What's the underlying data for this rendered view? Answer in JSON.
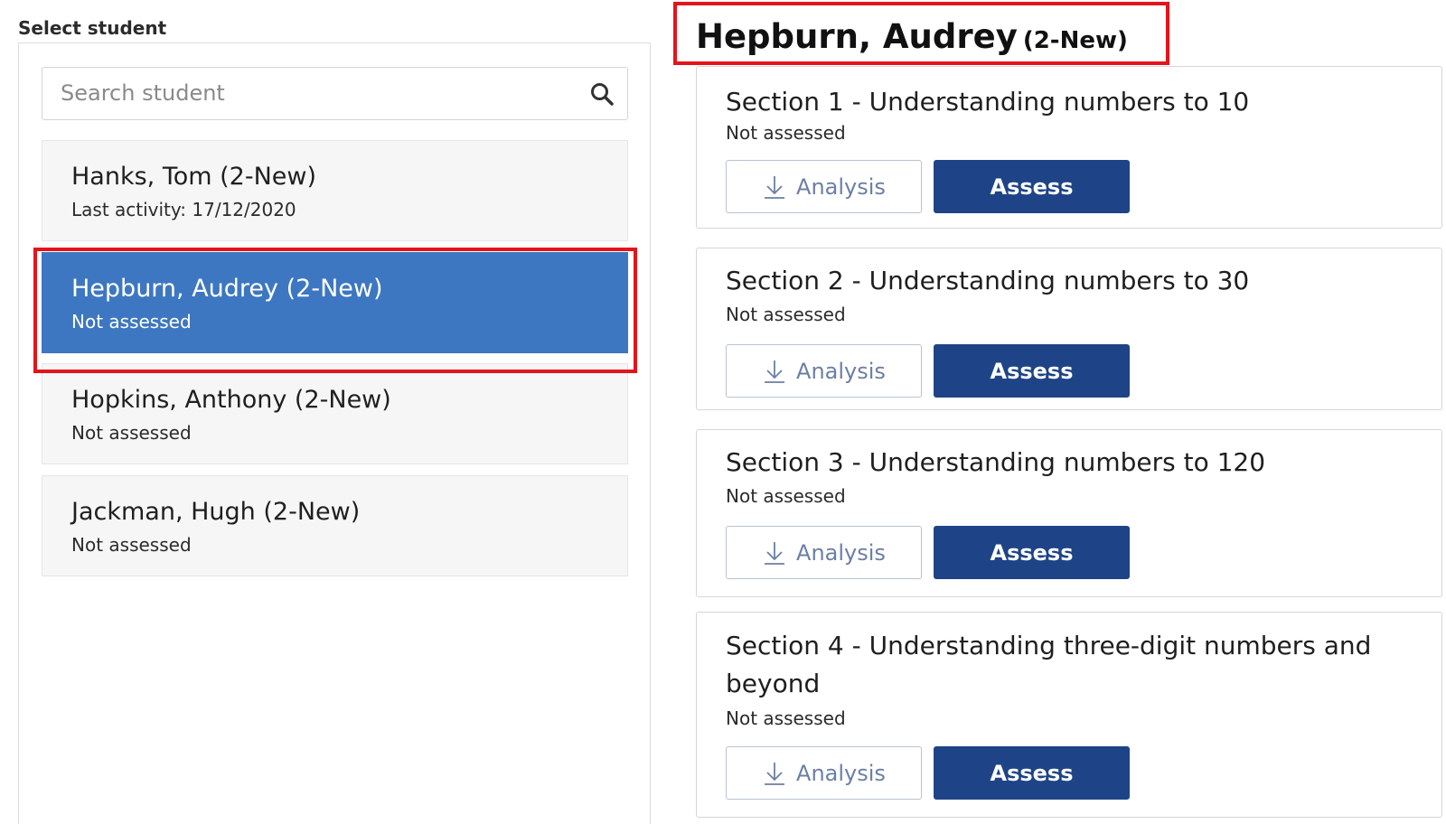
{
  "student_list": {
    "label": "Select student",
    "search": {
      "placeholder": "Search student",
      "value": ""
    },
    "students": [
      {
        "name": "Hanks, Tom (2-New)",
        "status": "Last activity: 17/12/2020",
        "selected": false
      },
      {
        "name": "Hepburn, Audrey (2-New)",
        "status": "Not assessed",
        "selected": true
      },
      {
        "name": "Hopkins, Anthony (2-New)",
        "status": "Not assessed",
        "selected": false
      },
      {
        "name": "Jackman, Hugh (2-New)",
        "status": "Not assessed",
        "selected": false
      }
    ]
  },
  "detail": {
    "student_name": "Hepburn, Audrey",
    "group": "(2-New)",
    "sections": [
      {
        "title": "Section 1 - Understanding numbers to 10",
        "status": "Not assessed",
        "analysis_label": "Analysis",
        "assess_label": "Assess"
      },
      {
        "title": "Section 2 - Understanding numbers to 30",
        "status": "Not assessed",
        "analysis_label": "Analysis",
        "assess_label": "Assess"
      },
      {
        "title": "Section 3 - Understanding numbers to 120",
        "status": "Not assessed",
        "analysis_label": "Analysis",
        "assess_label": "Assess"
      },
      {
        "title": "Section 4 - Understanding three-digit numbers and beyond",
        "status": "Not assessed",
        "analysis_label": "Analysis",
        "assess_label": "Assess"
      }
    ]
  },
  "colors": {
    "selected_row": "#3d77c1",
    "assess_button": "#1e4487",
    "annotation_highlight": "#e4141b"
  },
  "icons": {
    "search": "search-icon",
    "download": "download-icon"
  }
}
